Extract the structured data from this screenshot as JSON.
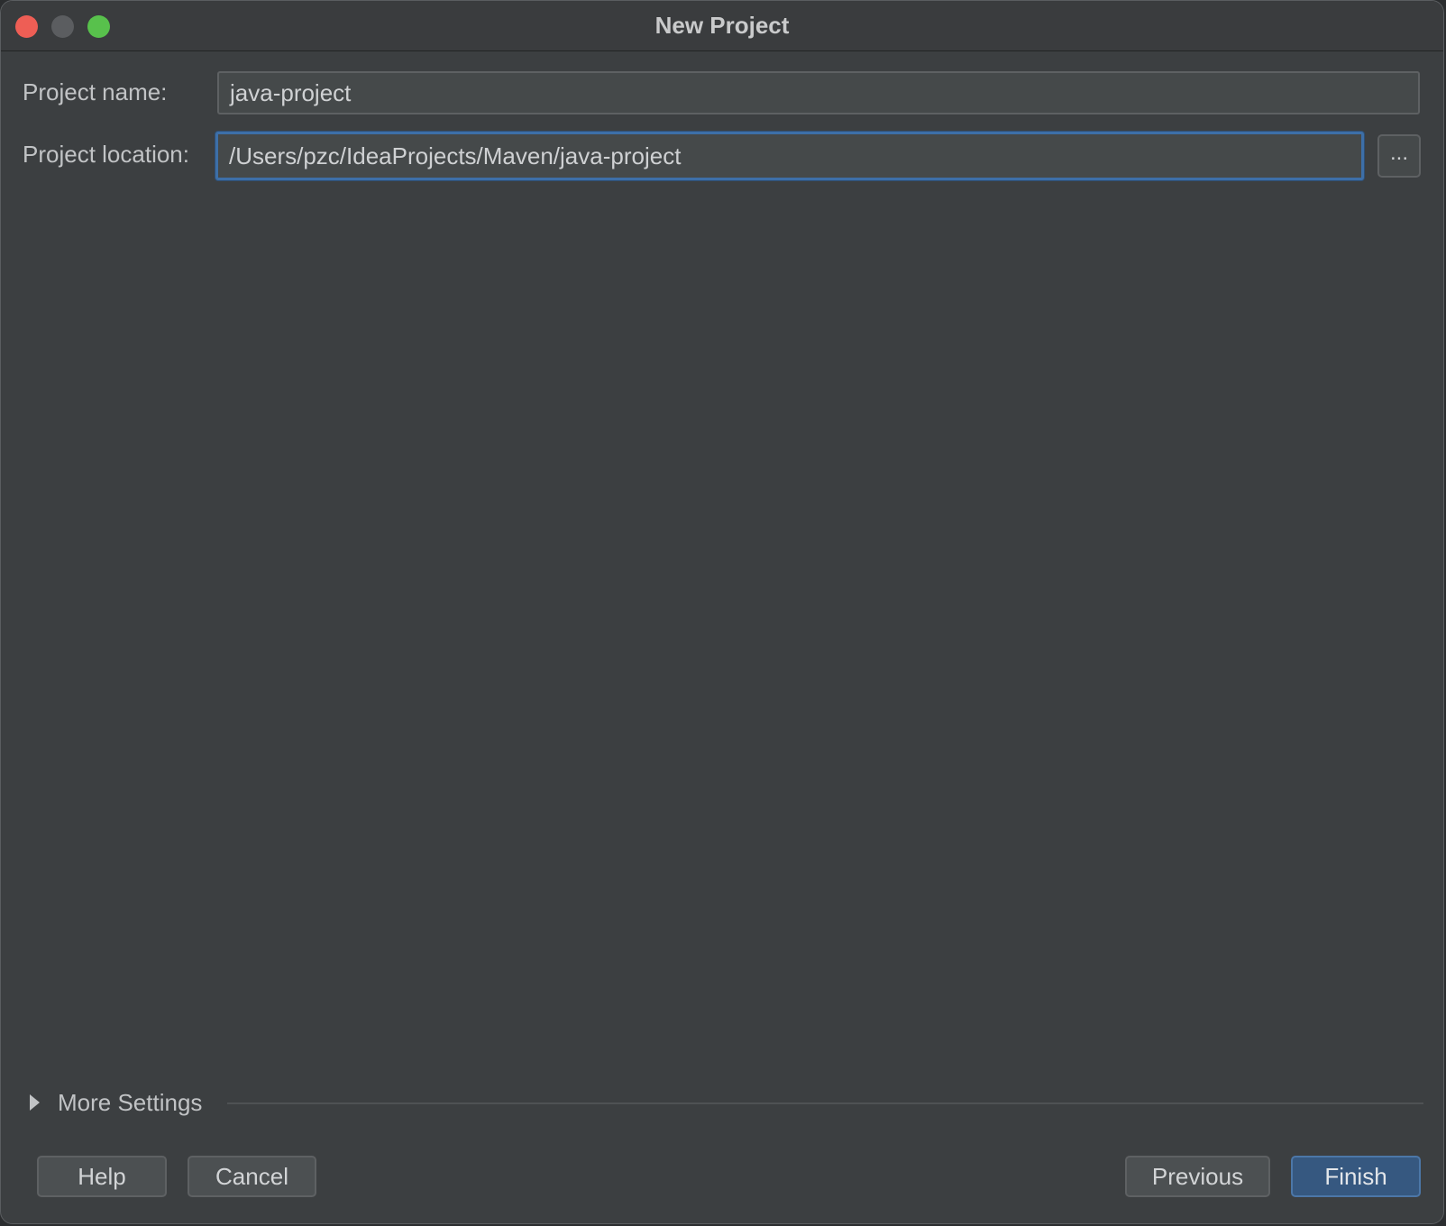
{
  "window": {
    "title": "New Project"
  },
  "form": {
    "project_name_label": "Project name:",
    "project_name_value": "java-project",
    "project_location_label": "Project location:",
    "project_location_value": "/Users/pzc/IdeaProjects/Maven/java-project",
    "browse_label": "..."
  },
  "more_settings": {
    "label": "More Settings",
    "expanded": false
  },
  "footer": {
    "help_label": "Help",
    "cancel_label": "Cancel",
    "previous_label": "Previous",
    "finish_label": "Finish"
  },
  "colors": {
    "background": "#3c3f41",
    "input_background": "#45494a",
    "focus_border": "#3d6fa8",
    "primary_button": "#365880",
    "close": "#ee5e55",
    "minimize": "#5b5d60",
    "zoom": "#58c14c"
  }
}
